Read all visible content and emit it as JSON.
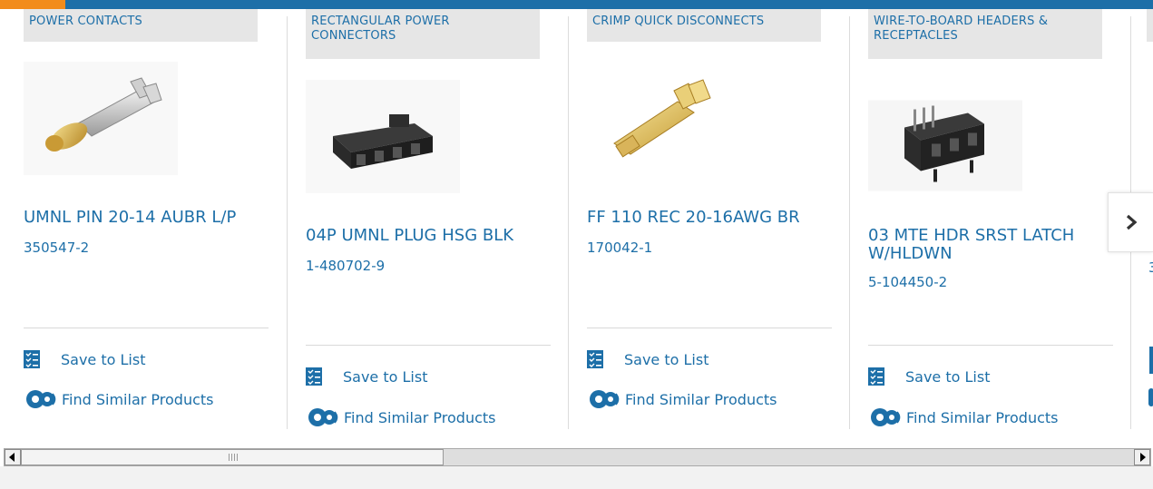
{
  "colors": {
    "brand_blue": "#1d6fa8",
    "accent_orange": "#f28c1c",
    "tag_bg": "#e6e6e6"
  },
  "cards": [
    {
      "category": "POWER CONTACTS",
      "title": "UMNL PIN 20-14 AUBR L/P",
      "part_number": "350547-2",
      "save_label": "Save to List",
      "similar_label": "Find Similar Products"
    },
    {
      "category": "RECTANGULAR POWER CONNECTORS",
      "title": "04P UMNL PLUG HSG BLK",
      "part_number": "1-480702-9",
      "save_label": "Save to List",
      "similar_label": "Find Similar Products"
    },
    {
      "category": "CRIMP QUICK DISCONNECTS",
      "title": "FF 110 REC 20-16AWG BR",
      "part_number": "170042-1",
      "save_label": "Save to List",
      "similar_label": "Find Similar Products"
    },
    {
      "category": "WIRE-TO-BOARD HEADERS & RECEPTACLES",
      "title": "03 MTE HDR SRST LATCH W/HLDWN",
      "part_number": "5-104450-2",
      "save_label": "Save to List",
      "similar_label": "Find Similar Products"
    }
  ],
  "partial_card": {
    "part_number_fragment": "3"
  },
  "icons": {
    "next": "chevron-right-icon",
    "save": "checklist-icon",
    "similar": "gears-icon",
    "scroll_left": "scroll-left-arrow-icon",
    "scroll_right": "scroll-right-arrow-icon"
  }
}
